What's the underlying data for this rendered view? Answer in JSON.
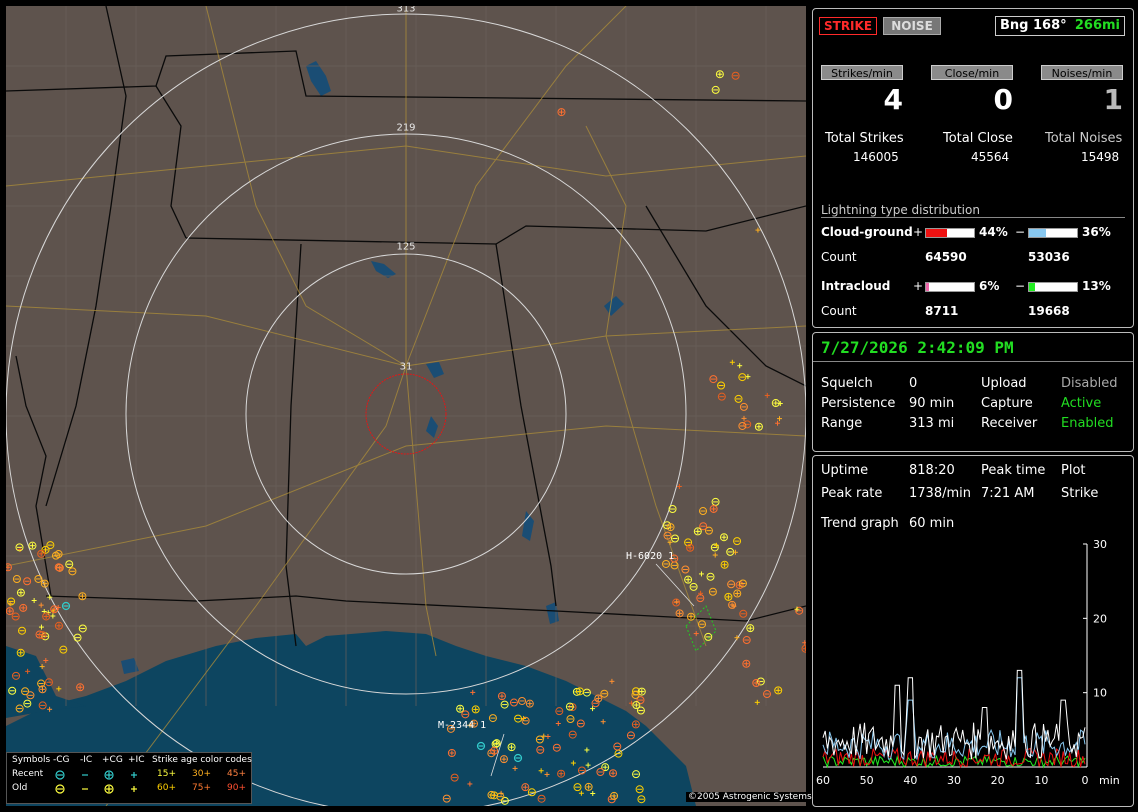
{
  "map": {
    "ring_labels": [
      "313",
      "219",
      "125",
      "31"
    ],
    "site_labels": [
      "H-6020 1",
      "M-2344 1"
    ],
    "copyright": "©2005 Astrogenic Systems",
    "legend": {
      "header": [
        "Symbols",
        "-CG",
        "-IC",
        "+CG",
        "+IC",
        "Strike age color codes"
      ],
      "recent_label": "Recent",
      "old_label": "Old",
      "age_recent": [
        "15+",
        "30+",
        "45+"
      ],
      "age_old": [
        "60+",
        "75+",
        "90+"
      ],
      "age_colors_recent": [
        "#ffff40",
        "#ffb020",
        "#ff8040"
      ],
      "age_colors_old": [
        "#ffd000",
        "#ff7a30",
        "#ff5030"
      ]
    }
  },
  "status": {
    "strike_btn": "STRIKE",
    "noise_btn": "NOISE",
    "bearing": "Bng 168°",
    "distance": "266mi",
    "headers": [
      "Strikes/min",
      "Close/min",
      "Noises/min"
    ],
    "rates": [
      "4",
      "0",
      "1"
    ],
    "total_labels": [
      "Total Strikes",
      "Total Close",
      "Total Noises"
    ],
    "totals": [
      "146005",
      "45564",
      "15498"
    ],
    "dist_title": "Lightning type distribution",
    "cg_label": "Cloud-ground",
    "ic_label": "Intracloud",
    "count_label": "Count",
    "plus": "+",
    "minus": "−",
    "cg_pos_pct": "44%",
    "cg_neg_pct": "36%",
    "ic_pos_pct": "6%",
    "ic_neg_pct": "13%",
    "cg_pos_count": "64590",
    "cg_neg_count": "53036",
    "ic_pos_count": "8711",
    "ic_neg_count": "19668",
    "bar_levels": {
      "cg_pos": 0.44,
      "cg_neg": 0.36,
      "ic_pos": 0.06,
      "ic_neg": 0.13
    },
    "bar_colors": {
      "cg_pos": "#ee1111",
      "cg_neg": "#88c8f0",
      "ic_pos": "#ee66aa",
      "ic_neg": "#22ee22"
    }
  },
  "settings": {
    "datetime": "7/27/2026 2:42:09 PM",
    "squelch_label": "Squelch",
    "squelch": "0",
    "persistence_label": "Persistence",
    "persistence": "90 min",
    "range_label": "Range",
    "range": "313 mi",
    "upload_label": "Upload",
    "upload": "Disabled",
    "capture_label": "Capture",
    "capture": "Active",
    "receiver_label": "Receiver",
    "receiver": "Enabled"
  },
  "stats": {
    "uptime_label": "Uptime",
    "uptime": "818:20",
    "peak_time_label": "Peak time",
    "peak_time": "7:21 AM",
    "plot_label": "Plot",
    "plot": "Strike",
    "peak_rate_label": "Peak rate",
    "peak_rate": "1738/min",
    "trend_label": "Trend graph",
    "trend": "60 min"
  },
  "chart_data": {
    "type": "line",
    "x_ticks": [
      "60",
      "50",
      "40",
      "30",
      "20",
      "10",
      "0"
    ],
    "x_unit": "min",
    "y_ticks": [
      "30",
      "20",
      "10"
    ],
    "ylim": [
      0,
      30
    ],
    "xlim": [
      60,
      0
    ]
  }
}
